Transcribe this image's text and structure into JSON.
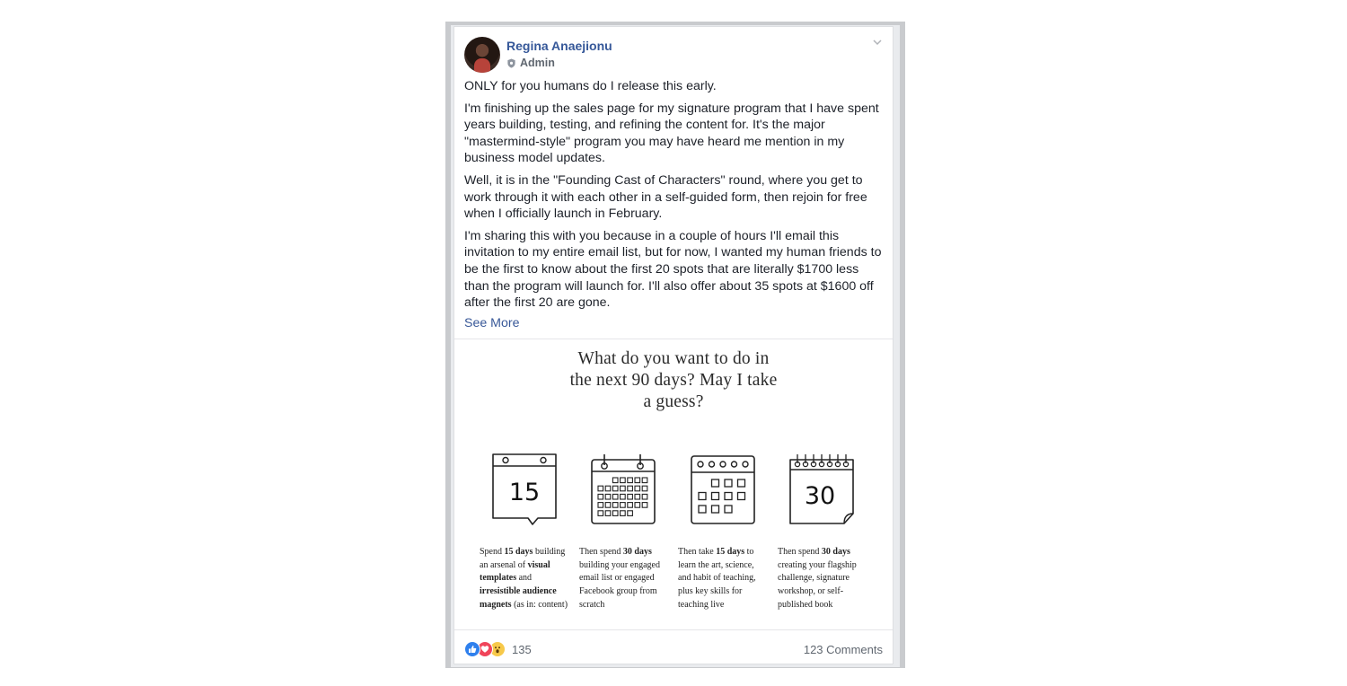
{
  "post": {
    "author": "Regina Anaejionu",
    "role": "Admin",
    "paragraphs": [
      "ONLY for you humans do I release this early.",
      "I'm finishing up the sales page for my signature program that I have spent years building, testing, and refining the content for. It's the major \"mastermind-style\" program you may have heard me mention in my business model updates.",
      "Well, it is in the \"Founding Cast of Characters\" round, where you get to work through it with each other in a self-guided form, then rejoin for free when I officially launch in February.",
      "I'm sharing this with you because in a couple of hours I'll email this invitation to my entire email list, but for now, I wanted my human friends to be the first to know about the first 20 spots that are literally $1700 less than the program will launch for. I'll also offer about 35 spots at $1600 off after the first 20 are gone."
    ],
    "see_more": "See More"
  },
  "promo": {
    "headline": "What do you want to do in\nthe next 90 days? May I take\na guess?",
    "calendars": [
      {
        "icon": "calendar-15-icon",
        "number": "15"
      },
      {
        "icon": "calendar-grid-icon",
        "number": ""
      },
      {
        "icon": "calendar-grid-small-icon",
        "number": ""
      },
      {
        "icon": "calendar-30-icon",
        "number": "30"
      }
    ],
    "steps": [
      {
        "parts": [
          [
            "Spend ",
            false
          ],
          [
            "15 days",
            true
          ],
          [
            " building an arsenal of ",
            false
          ],
          [
            "visual templates",
            true
          ],
          [
            " and ",
            false
          ],
          [
            "irresistible audience magnets",
            true
          ],
          [
            " (as in: content)",
            false
          ]
        ]
      },
      {
        "parts": [
          [
            "Then spend ",
            false
          ],
          [
            "30 days",
            true
          ],
          [
            " building your engaged email list or engaged Facebook group from scratch",
            false
          ]
        ]
      },
      {
        "parts": [
          [
            "Then take ",
            false
          ],
          [
            "15 days",
            true
          ],
          [
            " to learn the art, science, and habit of teaching, plus key skills for teaching live",
            false
          ]
        ]
      },
      {
        "parts": [
          [
            "Then spend ",
            false
          ],
          [
            "30 days",
            true
          ],
          [
            " creating your flagship challenge, signature workshop, or self-published book",
            false
          ]
        ]
      }
    ]
  },
  "footer": {
    "reaction_icons": [
      "like-icon",
      "love-icon",
      "wow-icon"
    ],
    "reaction_count": "135",
    "comments": "123 Comments"
  },
  "colors": {
    "link": "#365899",
    "secondary_text": "#606770",
    "like": "#2f80ed",
    "love": "#f0445a",
    "wow": "#f7c94a"
  }
}
